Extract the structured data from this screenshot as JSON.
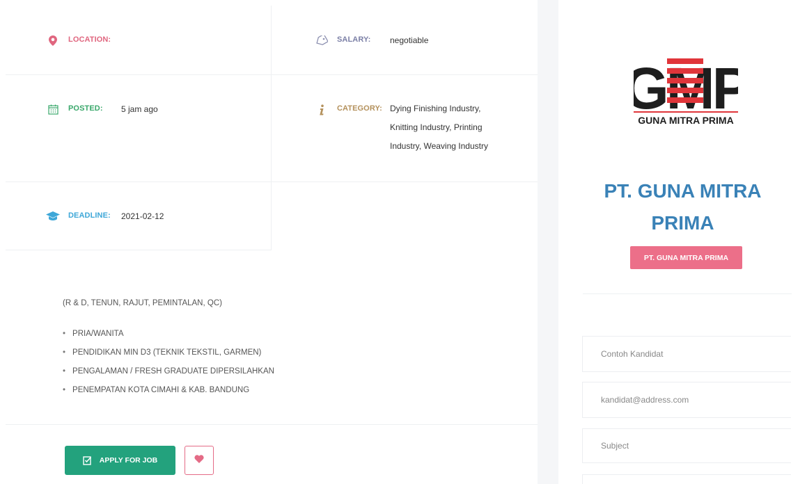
{
  "meta": {
    "location": {
      "label": "LOCATION:",
      "value": ""
    },
    "salary": {
      "label": "SALARY:",
      "value": "negotiable"
    },
    "posted": {
      "label": "POSTED:",
      "value": "5 jam ago"
    },
    "category": {
      "label": "CATEGORY:",
      "lines": [
        "Dying Finishing Industry,",
        "Knitting Industry, Printing",
        "Industry, Weaving Industry"
      ]
    },
    "deadline": {
      "label": "DEADLINE:",
      "value": "2021-02-12"
    }
  },
  "description": {
    "intro": "(R & D, TENUN, RAJUT, PEMINTALAN, QC)",
    "items": [
      "PRIA/WANITA",
      "PENDIDIKAN MIN D3 (TEKNIK TEKSTIL, GARMEN)",
      "PENGALAMAN / FRESH GRADUATE DIPERSILAHKAN",
      "PENEMPATAN KOTA CIMAHI & KAB. BANDUNG"
    ]
  },
  "actions": {
    "apply_label": "APPLY FOR JOB"
  },
  "company": {
    "logo_letters": "GMP",
    "logo_caption": "GUNA MITRA PRIMA",
    "name_line1": "PT. GUNA MITRA",
    "name_line2": "PRIMA",
    "badge": "PT. GUNA MITRA PRIMA"
  },
  "contact_form": {
    "name_placeholder": "Contoh Kandidat",
    "email_placeholder": "kandidat@address.com",
    "subject_placeholder": "Subject"
  },
  "colors": {
    "apply_green": "#23a27d",
    "accent_pink": "#ec6f89",
    "company_blue": "#3a82b7",
    "logo_red": "#e0353a"
  },
  "icons": {
    "location": "map-pin-icon",
    "salary": "tag-icon",
    "posted": "calendar-icon",
    "category": "info-icon",
    "deadline": "graduation-cap-icon",
    "apply": "checkbox-edit-icon",
    "favorite": "heart-icon"
  }
}
